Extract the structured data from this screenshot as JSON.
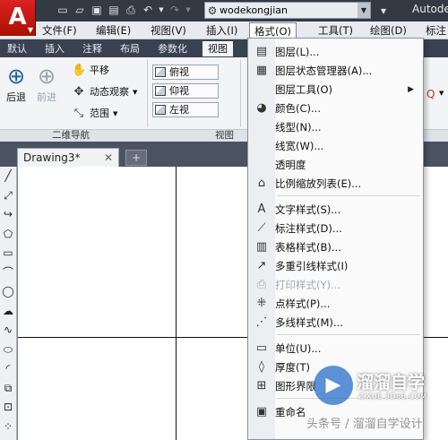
{
  "app": {
    "logo_letter": "A",
    "title": "Autodesk",
    "workspace": "wodekongjian"
  },
  "menubar": [
    {
      "label": "文件(F)"
    },
    {
      "label": "编辑(E)"
    },
    {
      "label": "视图(V)"
    },
    {
      "label": "插入(I)"
    },
    {
      "label": "格式(O)",
      "active": true
    },
    {
      "label": "工具(T)"
    },
    {
      "label": "绘图(D)"
    },
    {
      "label": "标注"
    }
  ],
  "ribbon_tabs": [
    "默认",
    "插入",
    "注释",
    "布局",
    "参数化",
    "视图"
  ],
  "ribbon": {
    "back_label": "后退",
    "forward_label": "前进",
    "pan_label": "平移",
    "orbit_label": "动态观察",
    "range_label": "范围",
    "nav_panel_label": "二维导航",
    "view_top": "俯视",
    "view_bottom": "仰视",
    "view_left": "左视",
    "view_panel_label": "视图"
  },
  "document": {
    "tab_label": "Drawing3*"
  },
  "format_menu": {
    "items": [
      {
        "label": "图层(L)...",
        "icon": "layers-icon",
        "glyph": "▤"
      },
      {
        "label": "图层状态管理器(A)...",
        "icon": "layer-state-icon",
        "glyph": "▦"
      },
      {
        "label": "图层工具(O)",
        "icon": "",
        "glyph": "",
        "submenu": true
      },
      {
        "label": "颜色(C)...",
        "icon": "color-wheel-icon",
        "glyph": "◕"
      },
      {
        "label": "线型(N)...",
        "icon": "",
        "glyph": ""
      },
      {
        "label": "线宽(W)...",
        "icon": "",
        "glyph": ""
      },
      {
        "label": "透明度",
        "icon": "",
        "glyph": ""
      },
      {
        "label": "比例缩放列表(E)...",
        "icon": "scale-list-icon",
        "glyph": "⌂",
        "sep_after": true
      },
      {
        "label": "文字样式(S)...",
        "icon": "text-style-icon",
        "glyph": "A"
      },
      {
        "label": "标注样式(D)...",
        "icon": "dim-style-icon",
        "glyph": "⟋"
      },
      {
        "label": "表格样式(B)...",
        "icon": "table-style-icon",
        "glyph": "▥"
      },
      {
        "label": "多重引线样式(I)",
        "icon": "multileader-icon",
        "glyph": "↗"
      },
      {
        "label": "打印样式(Y)...",
        "icon": "print-style-icon",
        "glyph": "⎙",
        "disabled": true
      },
      {
        "label": "点样式(P)...",
        "icon": "point-style-icon",
        "glyph": "⁜"
      },
      {
        "label": "多线样式(M)...",
        "icon": "multiline-icon",
        "glyph": "⋰",
        "sep_after": true
      },
      {
        "label": "单位(U)...",
        "icon": "units-icon",
        "glyph": "▭"
      },
      {
        "label": "厚度(T)",
        "icon": "thickness-icon",
        "glyph": "◊"
      },
      {
        "label": "图形界限",
        "icon": "limits-icon",
        "glyph": "⊞",
        "sep_after": true
      },
      {
        "label": "重命名",
        "icon": "rename-icon",
        "glyph": "▣"
      }
    ]
  },
  "watermark": {
    "logo_glyph": "▶",
    "name": "溜溜自学",
    "url": "ZIXUE.3D66.COM",
    "caption": "头条号 / 溜溜自学设计"
  },
  "colors": {
    "menu_bg": "#fafafa",
    "ribbon_tab_bg": "#3a4150",
    "canvas_bg": "#ffffff",
    "logo_red": "#cc2211"
  }
}
